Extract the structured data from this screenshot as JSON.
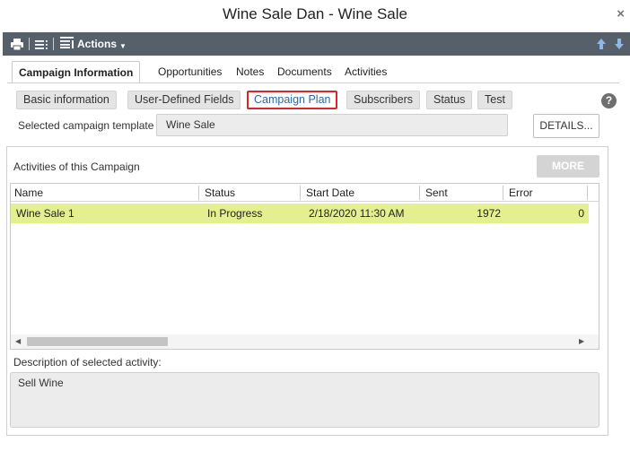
{
  "window": {
    "title": "Wine Sale Dan - Wine Sale",
    "close_glyph": "×"
  },
  "toolbar": {
    "icons": [
      "print-icon",
      "list-icon",
      "list-detail-icon"
    ],
    "actions_label": "Actions",
    "nav_icons": [
      "arrow-up-icon",
      "arrow-down-icon"
    ],
    "icon_color": "#ffffff",
    "background": "#55606b"
  },
  "main_tabs": [
    {
      "label": "Campaign Information",
      "active": true
    },
    {
      "label": "Opportunities"
    },
    {
      "label": "Notes"
    },
    {
      "label": "Documents"
    },
    {
      "label": "Activities"
    }
  ],
  "sub_tabs": [
    {
      "label": "Basic information"
    },
    {
      "label": "User-Defined Fields"
    },
    {
      "label": "Campaign Plan",
      "active": true
    },
    {
      "label": "Subscribers"
    },
    {
      "label": "Status"
    },
    {
      "label": "Test"
    }
  ],
  "help_glyph": "?",
  "template": {
    "label": "Selected campaign template",
    "value": "Wine Sale",
    "details_label": "DETAILS..."
  },
  "activities": {
    "label": "Activities of this Campaign",
    "more_label": "MORE",
    "columns": [
      "Name",
      "Status",
      "Start Date",
      "Sent",
      "Error"
    ],
    "rows": [
      {
        "name": "Wine Sale 1",
        "status": "In Progress",
        "start_date": "2/18/2020 11:30 AM",
        "sent": "1972",
        "error": "0"
      }
    ],
    "selected_row_color": "#e4ef8f"
  },
  "description": {
    "label": "Description of selected activity:",
    "value": "Sell Wine"
  },
  "colors": {
    "accent": "#2b68a6",
    "highlight_border": "#d9262c"
  }
}
